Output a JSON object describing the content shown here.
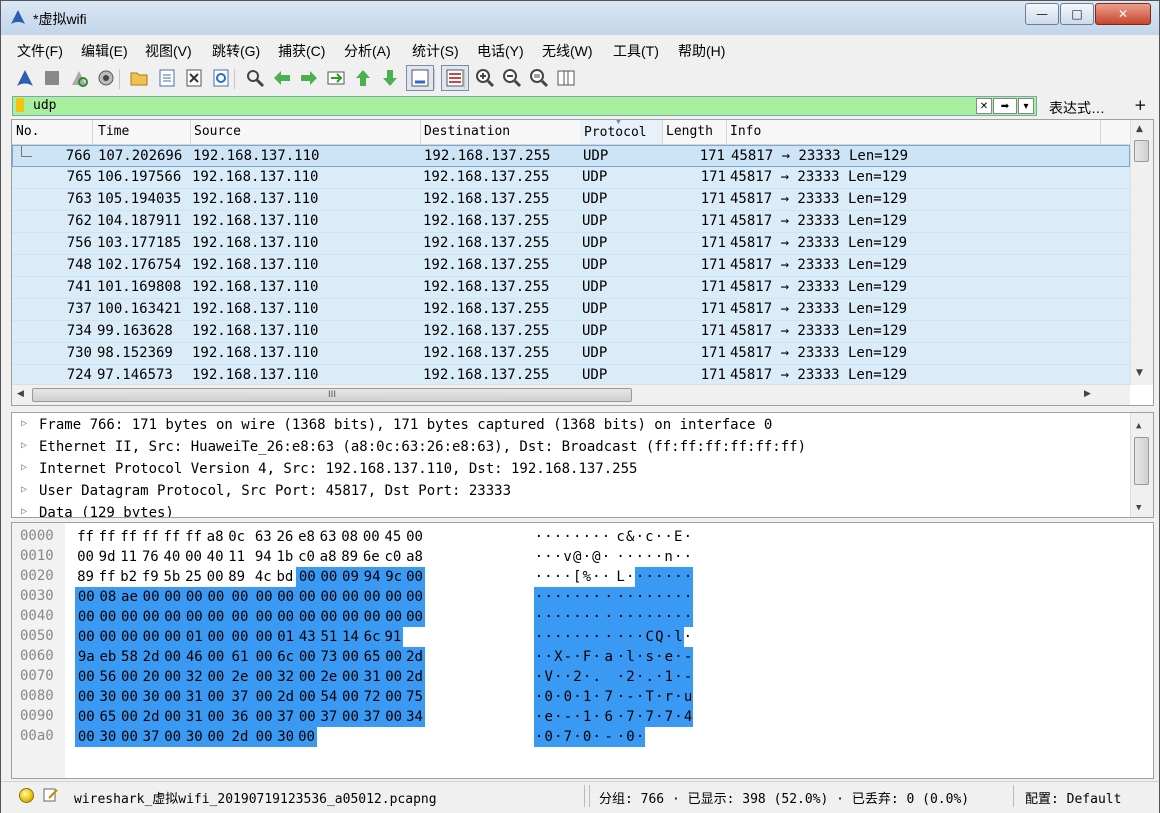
{
  "window": {
    "title": "*虚拟wifi",
    "minimize_label": "—",
    "maximize_label": "□",
    "close_label": "✕"
  },
  "menu": [
    "文件(F)",
    "编辑(E)",
    "视图(V)",
    "跳转(G)",
    "捕获(C)",
    "分析(A)",
    "统计(S)",
    "电话(Y)",
    "无线(W)",
    "工具(T)",
    "帮助(H)"
  ],
  "toolbar_icons": [
    "start-capture-icon",
    "stop-capture-icon",
    "restart-capture-icon",
    "capture-options-icon",
    "open-file-icon",
    "save-file-icon",
    "close-file-icon",
    "reload-file-icon",
    "find-packet-icon",
    "go-back-icon",
    "go-forward-icon",
    "go-to-packet-icon",
    "go-first-icon",
    "go-last-icon",
    "autoscroll-icon",
    "colorize-icon",
    "zoom-in-icon",
    "zoom-out-icon",
    "zoom-normal-icon",
    "resize-columns-icon"
  ],
  "filter": {
    "value": "udp",
    "expression_label": "表达式…",
    "plus_label": "+"
  },
  "packet_list": {
    "columns": [
      "No.",
      "Time",
      "Source",
      "Destination",
      "Protocol",
      "Length",
      "Info"
    ],
    "rows": [
      [
        "766",
        "107.202696",
        "192.168.137.110",
        "192.168.137.255",
        "UDP",
        "171",
        "45817 → 23333 Len=129"
      ],
      [
        "765",
        "106.197566",
        "192.168.137.110",
        "192.168.137.255",
        "UDP",
        "171",
        "45817 → 23333 Len=129"
      ],
      [
        "763",
        "105.194035",
        "192.168.137.110",
        "192.168.137.255",
        "UDP",
        "171",
        "45817 → 23333 Len=129"
      ],
      [
        "762",
        "104.187911",
        "192.168.137.110",
        "192.168.137.255",
        "UDP",
        "171",
        "45817 → 23333 Len=129"
      ],
      [
        "756",
        "103.177185",
        "192.168.137.110",
        "192.168.137.255",
        "UDP",
        "171",
        "45817 → 23333 Len=129"
      ],
      [
        "748",
        "102.176754",
        "192.168.137.110",
        "192.168.137.255",
        "UDP",
        "171",
        "45817 → 23333 Len=129"
      ],
      [
        "741",
        "101.169808",
        "192.168.137.110",
        "192.168.137.255",
        "UDP",
        "171",
        "45817 → 23333 Len=129"
      ],
      [
        "737",
        "100.163421",
        "192.168.137.110",
        "192.168.137.255",
        "UDP",
        "171",
        "45817 → 23333 Len=129"
      ],
      [
        "734",
        "99.163628",
        "192.168.137.110",
        "192.168.137.255",
        "UDP",
        "171",
        "45817 → 23333 Len=129"
      ],
      [
        "730",
        "98.152369",
        "192.168.137.110",
        "192.168.137.255",
        "UDP",
        "171",
        "45817 → 23333 Len=129"
      ],
      [
        "724",
        "97.146573",
        "192.168.137.110",
        "192.168.137.255",
        "UDP",
        "171",
        "45817 → 23333 Len=129"
      ]
    ],
    "hscroll_grip": "III"
  },
  "details": [
    "Frame 766: 171 bytes on wire (1368 bits), 171 bytes captured (1368 bits) on interface 0",
    "Ethernet II, Src: HuaweiTe_26:e8:63 (a8:0c:63:26:e8:63), Dst: Broadcast (ff:ff:ff:ff:ff:ff)",
    "Internet Protocol Version 4, Src: 192.168.137.110, Dst: 192.168.137.255",
    "User Datagram Protocol, Src Port: 45817, Dst Port: 23333",
    "Data (129 bytes)"
  ],
  "hex": {
    "highlight_start": 42,
    "rows": [
      {
        "offset": "0000",
        "bytes": [
          "ff",
          "ff",
          "ff",
          "ff",
          "ff",
          "ff",
          "a8",
          "0c",
          "63",
          "26",
          "e8",
          "63",
          "08",
          "00",
          "45",
          "00"
        ],
        "ascii": "········ c&·c··E·"
      },
      {
        "offset": "0010",
        "bytes": [
          "00",
          "9d",
          "11",
          "76",
          "40",
          "00",
          "40",
          "11",
          "94",
          "1b",
          "c0",
          "a8",
          "89",
          "6e",
          "c0",
          "a8"
        ],
        "ascii": "···v@·@· ·····n··"
      },
      {
        "offset": "0020",
        "bytes": [
          "89",
          "ff",
          "b2",
          "f9",
          "5b",
          "25",
          "00",
          "89",
          "4c",
          "bd",
          "00",
          "00",
          "09",
          "94",
          "9c",
          "00"
        ],
        "ascii": "····[%·· L·······"
      },
      {
        "offset": "0030",
        "bytes": [
          "00",
          "08",
          "ae",
          "00",
          "00",
          "00",
          "00",
          "00",
          "00",
          "00",
          "00",
          "00",
          "00",
          "00",
          "00",
          "00"
        ],
        "ascii": "········ ········"
      },
      {
        "offset": "0040",
        "bytes": [
          "00",
          "00",
          "00",
          "00",
          "00",
          "00",
          "00",
          "00",
          "00",
          "00",
          "00",
          "00",
          "00",
          "00",
          "00",
          "00"
        ],
        "ascii": "········ ········"
      },
      {
        "offset": "0050",
        "bytes": [
          "00",
          "00",
          "00",
          "00",
          "00",
          "01",
          "00",
          "00",
          "00",
          "01",
          "43",
          "51",
          "14",
          "6c",
          "91"
        ],
        "ascii": "········ ···CQ·l·"
      },
      {
        "offset": "0060",
        "bytes": [
          "9a",
          "eb",
          "58",
          "2d",
          "00",
          "46",
          "00",
          "61",
          "00",
          "6c",
          "00",
          "73",
          "00",
          "65",
          "00",
          "2d"
        ],
        "ascii": "··X-·F·a ·l·s·e·-"
      },
      {
        "offset": "0070",
        "bytes": [
          "00",
          "56",
          "00",
          "20",
          "00",
          "32",
          "00",
          "2e",
          "00",
          "32",
          "00",
          "2e",
          "00",
          "31",
          "00",
          "2d"
        ],
        "ascii": "·V· ·2·. ·2·.·1·-"
      },
      {
        "offset": "0080",
        "bytes": [
          "00",
          "30",
          "00",
          "30",
          "00",
          "31",
          "00",
          "37",
          "00",
          "2d",
          "00",
          "54",
          "00",
          "72",
          "00",
          "75"
        ],
        "ascii": "·0·0·1·7 ·-·T·r·u"
      },
      {
        "offset": "0090",
        "bytes": [
          "00",
          "65",
          "00",
          "2d",
          "00",
          "31",
          "00",
          "36",
          "00",
          "37",
          "00",
          "37",
          "00",
          "37",
          "00",
          "34"
        ],
        "ascii": "·e·-·1·6 ·7·7·7·4"
      },
      {
        "offset": "00a0",
        "bytes": [
          "00",
          "30",
          "00",
          "37",
          "00",
          "30",
          "00",
          "2d",
          "00",
          "30",
          "00"
        ],
        "ascii": "·0·7·0·- ·0·"
      }
    ]
  },
  "status": {
    "file": "wireshark_虚拟wifi_20190719123536_a05012.pcapng",
    "packets": "分组: 766 · 已显示: 398 (52.0%) · 已丢弃: 0 (0.0%)",
    "profile": "配置: Default"
  },
  "colors": {
    "row_bg": "#dbecf9",
    "filter_ok": "#a8f0a0",
    "hex_highlight": "#3a9af3"
  }
}
